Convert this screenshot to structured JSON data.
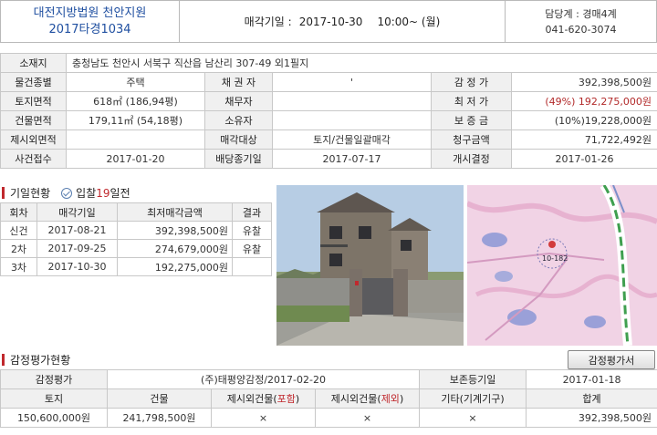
{
  "header": {
    "court": "대전지방법원 천안지원",
    "case_no": "2017타경1034",
    "sale_date_label": "매각기일 :",
    "sale_date": "2017-10-30",
    "sale_time": "10:00~ (월)",
    "dept": "담당계 : 경매4계",
    "phone": "041-620-3074"
  },
  "info": {
    "address_label": "소재지",
    "address": "충청남도 천안시 서북구 직산읍 남산리 307-49 외1필지",
    "rows": [
      {
        "l1": "물건종별",
        "v1": "주택",
        "l2": "채 권 자",
        "v2": "'",
        "l3": "감 정 가",
        "v3": "392,398,500원"
      },
      {
        "l1": "토지면적",
        "v1": "618㎡ (186,94평)",
        "l2": "채무자",
        "v2": "",
        "l3": "최 저 가",
        "v3": "(49%) 192,275,000원"
      },
      {
        "l1": "건물면적",
        "v1": "179,11㎡ (54,18평)",
        "l2": "소유자",
        "v2": "",
        "l3": "보 증 금",
        "v3": "(10%)19,228,000원"
      },
      {
        "l1": "제시외면적",
        "v1": "",
        "l2": "매각대상",
        "v2": "토지/건물일괄매각",
        "l3": "청구금액",
        "v3": "71,722,492원"
      },
      {
        "l1": "사건접수",
        "v1": "2017-01-20",
        "l2": "배당종기일",
        "v2": "2017-07-17",
        "l3": "개시결정",
        "v3": "2017-01-26"
      }
    ]
  },
  "history": {
    "title": "기일현황",
    "badge_prefix": "입찰",
    "badge_days": "19",
    "badge_suffix": "일전",
    "headers": [
      "회차",
      "매각기일",
      "최저매각금액",
      "결과"
    ],
    "rows": [
      {
        "round": "신건",
        "date": "2017-08-21",
        "price": "392,398,500원",
        "result": "유찰"
      },
      {
        "round": "2차",
        "date": "2017-09-25",
        "price": "274,679,000원",
        "result": "유찰"
      },
      {
        "round": "3차",
        "date": "2017-10-30",
        "price": "192,275,000원",
        "result": ""
      }
    ]
  },
  "map": {
    "label": "10-182"
  },
  "appraisal": {
    "title": "감정평가현황",
    "button": "감정평가서",
    "row1": {
      "l1": "감정평가",
      "v1": "(주)태평양감정/2017-02-20",
      "l2": "보존등기일",
      "v2": "2017-01-18"
    },
    "headers": {
      "land": "토지",
      "building": "건물",
      "extra_incl_prefix": "제시외건물(",
      "extra_incl_word": "포함",
      "extra_excl_prefix": "제시외건물(",
      "extra_excl_word": "제외",
      "close": ")",
      "other": "기타(기계기구)",
      "total": "합계"
    },
    "values": {
      "land": "150,600,000원",
      "building": "241,798,500원",
      "extra_incl": "×",
      "extra_excl": "×",
      "other": "×",
      "total": "392,398,500원"
    }
  }
}
